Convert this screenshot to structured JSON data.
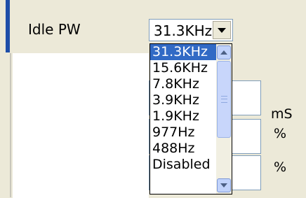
{
  "row": {
    "label": "Idle PW"
  },
  "combo": {
    "value": "31.3KHz"
  },
  "dropdown": {
    "options": [
      "31.3KHz",
      "15.6KHz",
      "7.8KHz",
      "3.9KHz",
      "1.9KHz",
      "977Hz",
      "488Hz",
      "Disabled"
    ],
    "selected_index": 0
  },
  "units": {
    "u1": "mS",
    "u2": "%",
    "u3": "%"
  },
  "colors": {
    "accent": "#1e4ea8",
    "selected": "#316ac5"
  }
}
